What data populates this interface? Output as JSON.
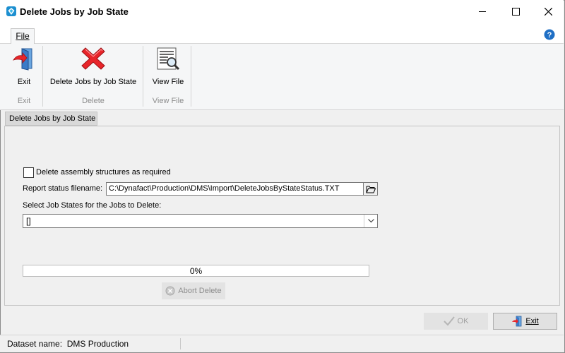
{
  "window": {
    "title": "Delete Jobs by Job State",
    "controls": [
      "minimize-icon",
      "maximize-icon",
      "close-icon"
    ]
  },
  "ribbon": {
    "file_tab": "File",
    "groups": [
      {
        "group_label": "Exit",
        "button_label": "Exit",
        "icon": "exit-door-icon"
      },
      {
        "group_label": "Delete",
        "button_label": "Delete Jobs by Job State",
        "icon": "red-x-delete-icon"
      },
      {
        "group_label": "View File",
        "button_label": "View File",
        "icon": "view-file-magnifier-icon"
      }
    ],
    "help_icon": "help-icon"
  },
  "document_tab": "Delete Jobs by Job State",
  "form": {
    "delete_assembly_label": "Delete assembly structures as required",
    "delete_assembly_checked": false,
    "report_filename_label": "Report status filename:",
    "report_filename_value": "C:\\Dynafact\\Production\\DMS\\Import\\DeleteJobsByStateStatus.TXT",
    "job_states_label": "Select Job States for the Jobs to Delete:",
    "job_states_value": "[]",
    "progress_text": "0%",
    "progress_value": 0,
    "abort_button": "Abort Delete"
  },
  "footer": {
    "ok_button": "OK",
    "exit_button": "Exit"
  },
  "status": {
    "dataset": "Dataset name:  DMS Production"
  },
  "colors": {
    "accent_red": "#e8252a",
    "help_blue": "#1f6fc5",
    "progress_green": "#06b025"
  }
}
